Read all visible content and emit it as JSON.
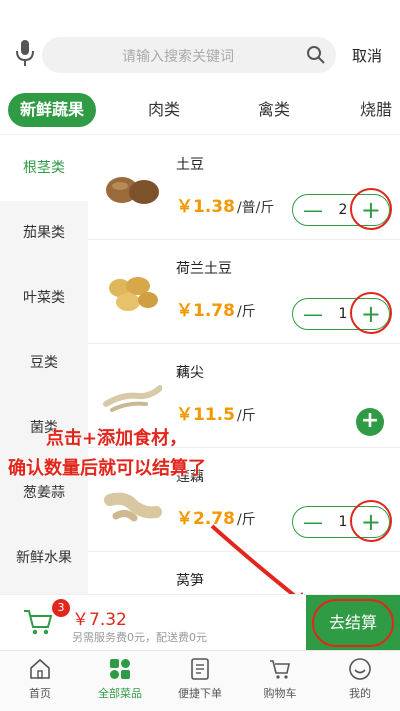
{
  "search": {
    "placeholder": "请输入搜索关键词",
    "cancel_label": "取消",
    "mic_icon": "microphone-icon",
    "search_icon": "search-icon"
  },
  "tabs": [
    {
      "label": "新鲜蔬果",
      "active": true
    },
    {
      "label": "肉类",
      "active": false
    },
    {
      "label": "禽类",
      "active": false
    },
    {
      "label": "烧腊",
      "active": false
    }
  ],
  "sidebar": {
    "items": [
      {
        "label": "根茎类",
        "active": true
      },
      {
        "label": "茄果类",
        "active": false
      },
      {
        "label": "叶菜类",
        "active": false
      },
      {
        "label": "豆类",
        "active": false
      },
      {
        "label": "菌类",
        "active": false
      },
      {
        "label": "葱姜蒜",
        "active": false
      },
      {
        "label": "新鲜水果",
        "active": false
      }
    ]
  },
  "products": [
    {
      "name": "土豆",
      "price": "￥1.38",
      "unit": "/普/斤",
      "qty": "2",
      "minus": "—",
      "plus": "+"
    },
    {
      "name": "荷兰土豆",
      "price": "￥1.78",
      "unit": "/斤",
      "qty": "1",
      "minus": "—",
      "plus": "+"
    },
    {
      "name": "藕尖",
      "price": "￥11.5",
      "unit": "/斤",
      "add": "+"
    },
    {
      "name": "莲藕",
      "price": "￥2.78",
      "unit": "/斤",
      "qty": "1",
      "minus": "—",
      "plus": "+"
    },
    {
      "name": "莴笋"
    }
  ],
  "annotation": {
    "line1": "点击+添加食材，",
    "line2": "确认数量后就可以结算了"
  },
  "cart": {
    "badge": "3",
    "total": "￥7.32",
    "fee_note": "另需服务费0元，配送费0元",
    "checkout_label": "去结算"
  },
  "colors": {
    "brand_green": "#2f9b45",
    "price_orange": "#f39800",
    "annotation_red": "#e3261c"
  },
  "bottom_nav": [
    {
      "label": "首页",
      "icon": "home-icon",
      "active": false
    },
    {
      "label": "全部菜品",
      "icon": "grid-icon",
      "active": true
    },
    {
      "label": "便捷下单",
      "icon": "order-icon",
      "active": false
    },
    {
      "label": "购物车",
      "icon": "cart-icon",
      "active": false
    },
    {
      "label": "我的",
      "icon": "smile-icon",
      "active": false
    }
  ]
}
